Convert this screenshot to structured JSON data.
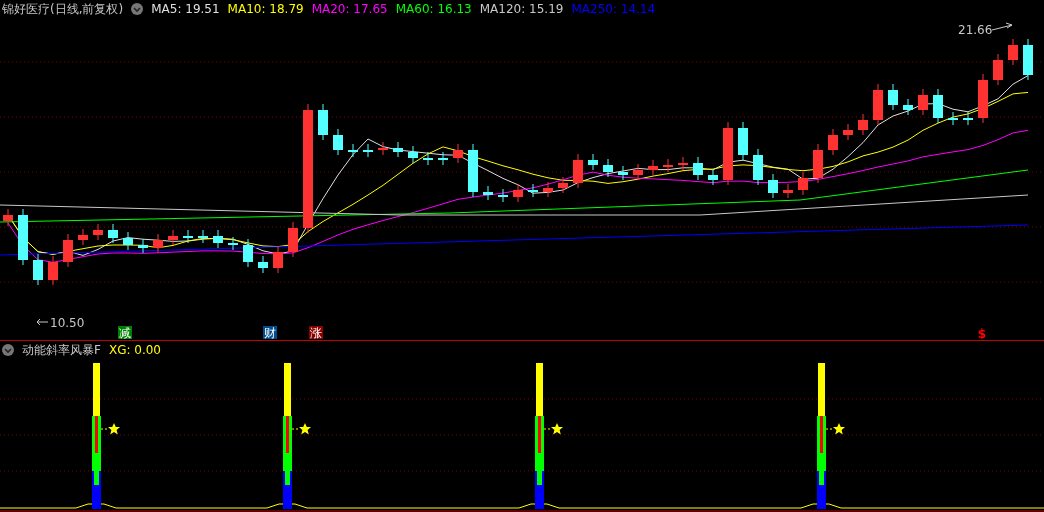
{
  "main_chart": {
    "title": "锦好医疗(日线,前复权)",
    "ma_legend": [
      {
        "label": "MA5: 19.51",
        "color": "#e0e0e0"
      },
      {
        "label": "MA10: 18.79",
        "color": "#ffff00"
      },
      {
        "label": "MA20: 17.65",
        "color": "#ff00ff"
      },
      {
        "label": "MA60: 16.13",
        "color": "#00ff00"
      },
      {
        "label": "MA120: 15.19",
        "color": "#c8c8c8"
      },
      {
        "label": "MA250: 14.14",
        "color": "#0000ff"
      }
    ],
    "high_label": "21.66",
    "low_label": "10.50",
    "markers": [
      {
        "text": "减",
        "color": "#008000"
      },
      {
        "text": "财",
        "color": "#004c8c"
      },
      {
        "text": "涨",
        "color": "#8c0000"
      },
      {
        "text": "$",
        "color": "#ff0000"
      }
    ]
  },
  "indicator": {
    "title": "动能斜率风暴F",
    "reading": "XG: 0.00"
  }
}
